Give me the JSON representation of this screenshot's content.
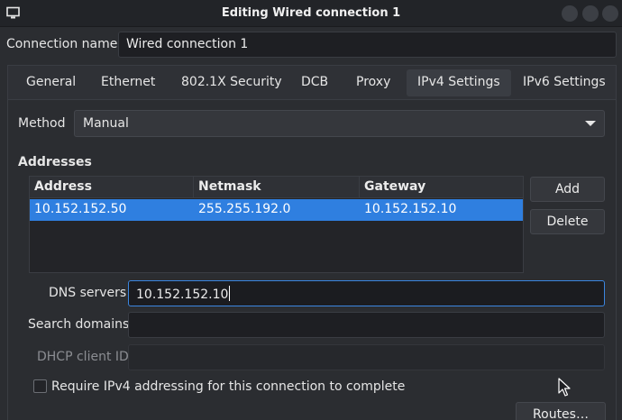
{
  "window": {
    "title": "Editing Wired connection 1"
  },
  "connection_name": {
    "label": "Connection name",
    "value": "Wired connection 1"
  },
  "tabs": [
    {
      "label": "General"
    },
    {
      "label": "Ethernet"
    },
    {
      "label": "802.1X Security"
    },
    {
      "label": "DCB"
    },
    {
      "label": "Proxy"
    },
    {
      "label": "IPv4 Settings",
      "active": true
    },
    {
      "label": "IPv6 Settings"
    }
  ],
  "method": {
    "label": "Method",
    "selected": "Manual"
  },
  "addresses": {
    "title": "Addresses",
    "columns": [
      "Address",
      "Netmask",
      "Gateway"
    ],
    "rows": [
      [
        "10.152.152.50",
        "255.255.192.0",
        "10.152.152.10"
      ]
    ],
    "add_label": "Add",
    "delete_label": "Delete"
  },
  "dns": {
    "label": "DNS servers",
    "value": "10.152.152.10"
  },
  "search_domains": {
    "label": "Search domains",
    "value": ""
  },
  "dhcp_client_id": {
    "label": "DHCP client ID",
    "value": ""
  },
  "require_ipv4": {
    "label": "Require IPv4 addressing for this connection to complete",
    "checked": false
  },
  "routes_button": {
    "label": "Routes…"
  },
  "colors": {
    "accent": "#2f7fe0",
    "focus_border": "#3b86e0",
    "background": "#2b2d31"
  }
}
